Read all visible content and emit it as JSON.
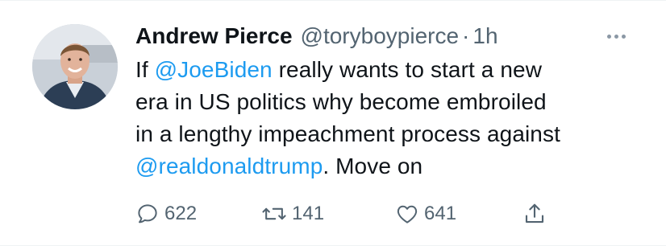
{
  "tweet": {
    "author": {
      "display_name": "Andrew Pierce",
      "handle": "@toryboypierce",
      "separator": "·",
      "timestamp": "1h"
    },
    "text": {
      "line1_pre": "If ",
      "line1_mention": "@JoeBiden",
      "line1_post": " really wants to start a new",
      "line2": "era in US politics why become embroiled",
      "line3": "in a lengthy impeachment process against",
      "line4_mention": "@realdonaldtrump",
      "line4_post": ". Move on"
    },
    "actions": {
      "replies": "622",
      "retweets": "141",
      "likes": "641"
    }
  },
  "icons": {
    "more": "more-horizontal-icon",
    "reply": "reply-bubble-icon",
    "retweet": "retweet-arrows-icon",
    "like": "heart-outline-icon",
    "share": "share-upload-icon"
  },
  "colors": {
    "text_primary": "#0f1419",
    "text_secondary": "#536471",
    "link": "#1d9bf0",
    "background": "#ffffff"
  }
}
